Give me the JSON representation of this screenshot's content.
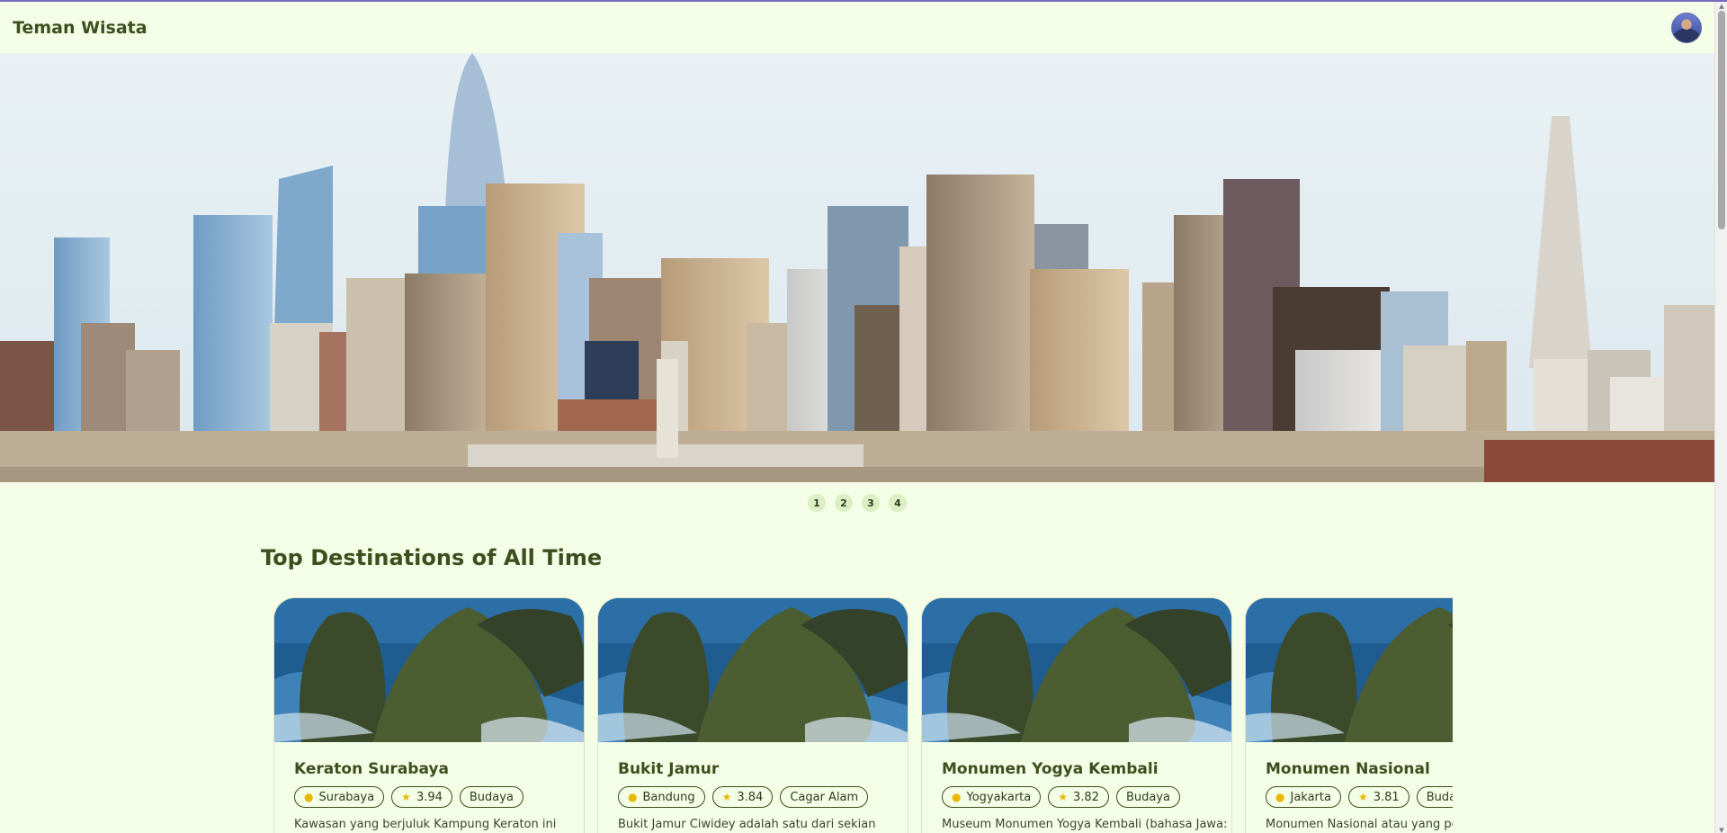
{
  "header": {
    "brand": "Teman Wisata",
    "avatar_icon": "user-avatar"
  },
  "hero": {
    "image": "city-skyline",
    "pages": [
      "1",
      "2",
      "3",
      "4"
    ]
  },
  "section": {
    "title": "Top Destinations of All Time"
  },
  "destinations": [
    {
      "name": "Keraton Surabaya",
      "city": "Surabaya",
      "rating": "3.94",
      "category": "Budaya",
      "description": "Kawasan yang berjuluk Kampung Keraton ini"
    },
    {
      "name": "Bukit Jamur",
      "city": "Bandung",
      "rating": "3.84",
      "category": "Cagar Alam",
      "description": "Bukit Jamur Ciwidey adalah satu dari sekian"
    },
    {
      "name": "Monumen Yogya Kembali",
      "city": "Yogyakarta",
      "rating": "3.82",
      "category": "Budaya",
      "description": "Museum Monumen Yogya Kembali (bahasa Jawa:"
    },
    {
      "name": "Monumen Nasional",
      "city": "Jakarta",
      "rating": "3.81",
      "category": "Budaya",
      "description": "Monumen Nasional atau yang popu"
    }
  ],
  "colors": {
    "background": "#f4fde6",
    "brand_text": "#3d4f1e",
    "star": "#e9b800",
    "pin": "#e9b800"
  }
}
